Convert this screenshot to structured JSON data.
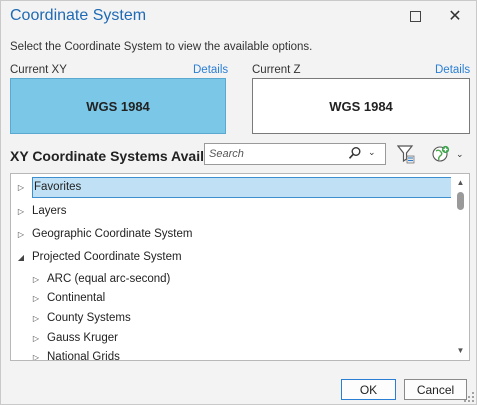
{
  "dialog": {
    "title": "Coordinate System",
    "instructions": "Select the Coordinate System to view the available options.",
    "accent_color": "#1f6ab4"
  },
  "current_xy": {
    "label": "Current XY",
    "details_link": "Details",
    "value": "WGS 1984",
    "selected_color": "#7ac7e8"
  },
  "current_z": {
    "label": "Current Z",
    "details_link": "Details",
    "value": "WGS 1984"
  },
  "available": {
    "title": "XY Coordinate Systems Available",
    "search_placeholder": "Search"
  },
  "tree": [
    {
      "label": "Favorites",
      "level": 0,
      "expander": "collapsed",
      "selected": true
    },
    {
      "label": "Layers",
      "level": 0,
      "expander": "collapsed",
      "selected": false
    },
    {
      "label": "Geographic Coordinate System",
      "level": 0,
      "expander": "collapsed",
      "selected": false
    },
    {
      "label": "Projected Coordinate System",
      "level": 0,
      "expander": "expanded",
      "selected": false
    },
    {
      "label": "ARC (equal arc-second)",
      "level": 1,
      "expander": "collapsed",
      "selected": false
    },
    {
      "label": "Continental",
      "level": 1,
      "expander": "collapsed",
      "selected": false
    },
    {
      "label": "County Systems",
      "level": 1,
      "expander": "collapsed",
      "selected": false
    },
    {
      "label": "Gauss Kruger",
      "level": 1,
      "expander": "collapsed",
      "selected": false
    },
    {
      "label": "National Grids",
      "level": 1,
      "expander": "collapsed",
      "selected": false
    }
  ],
  "buttons": {
    "ok": "OK",
    "cancel": "Cancel"
  }
}
